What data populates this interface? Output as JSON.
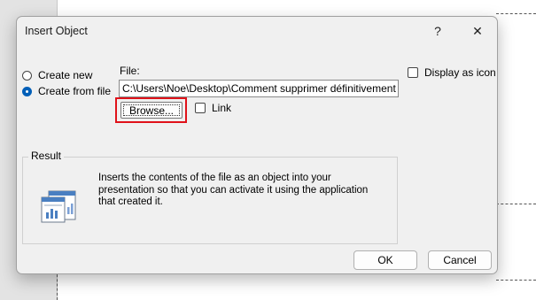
{
  "dialog": {
    "title": "Insert Object",
    "help_glyph": "?",
    "close_glyph": "✕"
  },
  "source": {
    "create_new_label": "Create new",
    "create_from_file_label": "Create from file",
    "selected": "create_from_file"
  },
  "file": {
    "label": "File:",
    "path": "C:\\Users\\Noe\\Desktop\\Comment supprimer définitivement d",
    "browse_label": "Browse...",
    "link_label": "Link",
    "link_checked": false
  },
  "display_as_icon": {
    "label": "Display as icon",
    "checked": false
  },
  "result": {
    "legend": "Result",
    "description": "Inserts the contents of the file as an object into your presentation so that you can activate it using the application that created it.",
    "icon": "embedded-document-icon"
  },
  "footer": {
    "ok_label": "OK",
    "cancel_label": "Cancel"
  },
  "colors": {
    "accent": "#005fb8",
    "highlight": "#e0121a",
    "dialog_bg": "#f0f0f0"
  }
}
